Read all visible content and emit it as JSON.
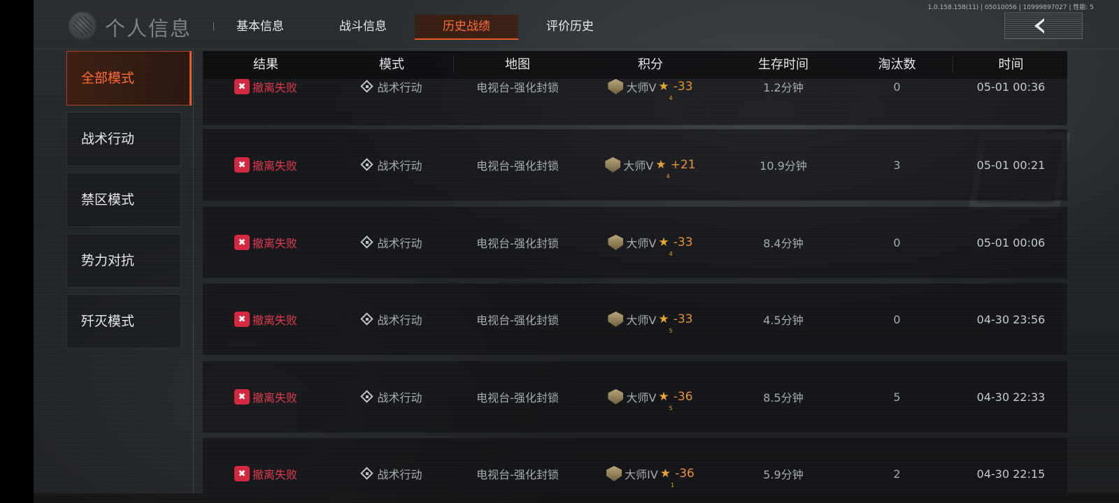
{
  "build_info": "1.0.158.158(11) | 05010056 | 10999897027 | 性能: 5",
  "header": {
    "title": "个人信息",
    "tabs": [
      {
        "label": "基本信息",
        "active": false
      },
      {
        "label": "战斗信息",
        "active": false
      },
      {
        "label": "历史战绩",
        "active": true
      },
      {
        "label": "评价历史",
        "active": false
      }
    ],
    "back_icon": "chevron-left-icon"
  },
  "sidebar": {
    "items": [
      {
        "label": "全部模式",
        "active": true
      },
      {
        "label": "战术行动",
        "active": false
      },
      {
        "label": "禁区模式",
        "active": false
      },
      {
        "label": "势力对抗",
        "active": false
      },
      {
        "label": "歼灭模式",
        "active": false
      }
    ]
  },
  "table": {
    "columns": [
      "结果",
      "模式",
      "地图",
      "积分",
      "生存时间",
      "淘汰数",
      "时间"
    ],
    "rows": [
      {
        "result": "撤离失败",
        "mode": "战术行动",
        "map": "电视台-强化封锁",
        "rank": "大师V",
        "star_level": "4",
        "delta": "-33",
        "survival": "1.2分钟",
        "kills": "0",
        "time": "05-01 00:36"
      },
      {
        "result": "撤离失败",
        "mode": "战术行动",
        "map": "电视台-强化封锁",
        "rank": "大师V",
        "star_level": "4",
        "delta": "+21",
        "survival": "10.9分钟",
        "kills": "3",
        "time": "05-01 00:21"
      },
      {
        "result": "撤离失败",
        "mode": "战术行动",
        "map": "电视台-强化封锁",
        "rank": "大师V",
        "star_level": "4",
        "delta": "-33",
        "survival": "8.4分钟",
        "kills": "0",
        "time": "05-01 00:06"
      },
      {
        "result": "撤离失败",
        "mode": "战术行动",
        "map": "电视台-强化封锁",
        "rank": "大师V",
        "star_level": "5",
        "delta": "-33",
        "survival": "4.5分钟",
        "kills": "0",
        "time": "04-30 23:56"
      },
      {
        "result": "撤离失败",
        "mode": "战术行动",
        "map": "电视台-强化封锁",
        "rank": "大师V",
        "star_level": "5",
        "delta": "-36",
        "survival": "8.5分钟",
        "kills": "5",
        "time": "04-30 22:33"
      },
      {
        "result": "撤离失败",
        "mode": "战术行动",
        "map": "电视台-强化封锁",
        "rank": "大师IV",
        "star_level": "1",
        "delta": "-36",
        "survival": "5.9分钟",
        "kills": "2",
        "time": "04-30 22:15"
      }
    ]
  },
  "colors": {
    "accent": "#e95a1c",
    "fail_red": "#d4283e",
    "score_orange": "#e8912d",
    "star_gold": "#e6a62a"
  }
}
